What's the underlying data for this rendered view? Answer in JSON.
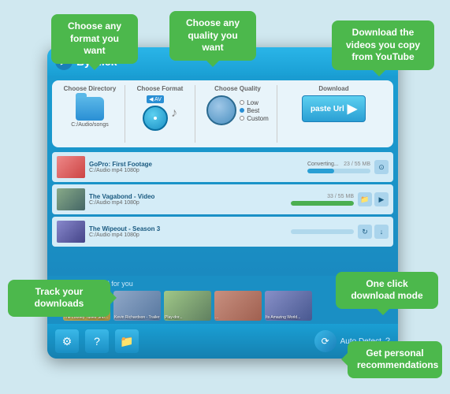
{
  "tooltips": {
    "format": "Choose any format you want",
    "quality": "Choose any quality you want",
    "download_copy": "Download the videos you copy from YouTube",
    "track": "Track your downloads",
    "oneclick": "One click download mode",
    "recommendations": "Get personal recommendations"
  },
  "app": {
    "title": "ByClick",
    "dropdown": "▼",
    "panels": {
      "directory_label": "Choose Directory",
      "format_label": "Choose Format",
      "quality_label": "Choose Quality",
      "download_label": "Download",
      "folder_path": "C:/Audio/songs",
      "av_tag": "◀ AV",
      "quality_low": "Low",
      "quality_best": "Best",
      "quality_custom": "Custom",
      "paste_url": "paste Url",
      "paste_arrow": "▶"
    },
    "downloads": [
      {
        "title": "GoPro: First Footage",
        "meta": "C:/Audio  mp4  1080p",
        "status": "Converting...",
        "size": "23 / 55 MB",
        "progress": 42,
        "type": "converting"
      },
      {
        "title": "The Vagabond - Video",
        "meta": "C:/Audio  mp4  1080p",
        "status": "",
        "size": "33 / 55 MB",
        "progress": 100,
        "type": "done"
      },
      {
        "title": "The Wipeout - Season 3",
        "meta": "C:/Audio  mp4  1080p",
        "status": "",
        "size": "",
        "progress": 0,
        "type": "pending"
      }
    ],
    "bottom": {
      "settings_icon": "⚙",
      "help_icon": "?",
      "folder_icon": "📁",
      "auto_detect": "Auto Detect",
      "auto_detect_question": "?"
    },
    "recommended": {
      "label": "Recommended for you",
      "nav_left": "‹",
      "nav_right": "›",
      "items": [
        {
          "label": "The Looney Tunes Show..."
        },
        {
          "label": "Kevin Richardson - Trailer"
        },
        {
          "label": "Play-dor..."
        },
        {
          "label": "..."
        },
        {
          "label": "Its Amazing World..."
        }
      ]
    }
  }
}
